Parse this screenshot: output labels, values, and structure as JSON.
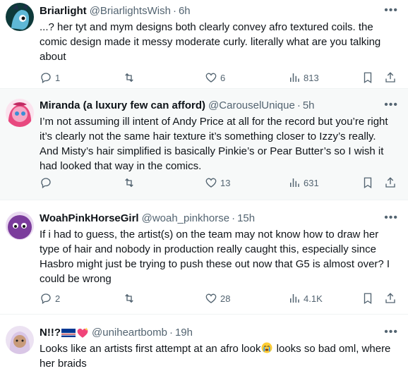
{
  "tweets": [
    {
      "name": "Briarlight",
      "handle": "@BriarlightsWish",
      "time": "6h",
      "text": "...? her tyt and mym designs both clearly convey afro textured coils. the comic design made it messy moderate curly. literally what are you talking about",
      "replies": "1",
      "retweets": "",
      "likes": "6",
      "views": "813",
      "avatar_color": "#0e3a3a"
    },
    {
      "name": "Miranda (a luxury few can afford)",
      "handle": "@CarouselUnique",
      "time": "5h",
      "text": "I’m not assuming ill intent of Andy Price at all for the record but you’re right it’s clearly not the same hair texture it’s something closer to Izzy’s really. And Misty’s hair simplified is basically Pinkie’s or Pear Butter’s so I wish it had looked that way in the comics.",
      "replies": "",
      "retweets": "",
      "likes": "13",
      "views": "631",
      "avatar_color": "#e8497f"
    },
    {
      "name": "WoahPinkHorseGirl",
      "handle": "@woah_pinkhorse",
      "time": "15h",
      "text": "If i had to guess, the artist(s) on the team may not know how to draw her type of hair and nobody in production really caught this, especially since Hasbro might just be trying to push these out now that G5 is almost over? I could be wrong",
      "replies": "2",
      "retweets": "",
      "likes": "28",
      "views": "4.1K",
      "avatar_color": "#7b3c9c"
    },
    {
      "name": "N!!?",
      "handle": "@uniheartbomb",
      "time": "19h",
      "text_before": "Looks like an artists first attempt at an afro look",
      "text_after": " looks so bad oml, where her braids",
      "avatar_color": "#d9c6e6"
    }
  ],
  "icons": [
    "reply-icon",
    "retweet-icon",
    "like-icon",
    "views-icon",
    "bookmark-icon",
    "share-icon",
    "more-icon"
  ],
  "colors": {
    "secondary": "#536471",
    "highlight_bg": "#f7f9f9",
    "divider": "#eff3f4"
  }
}
